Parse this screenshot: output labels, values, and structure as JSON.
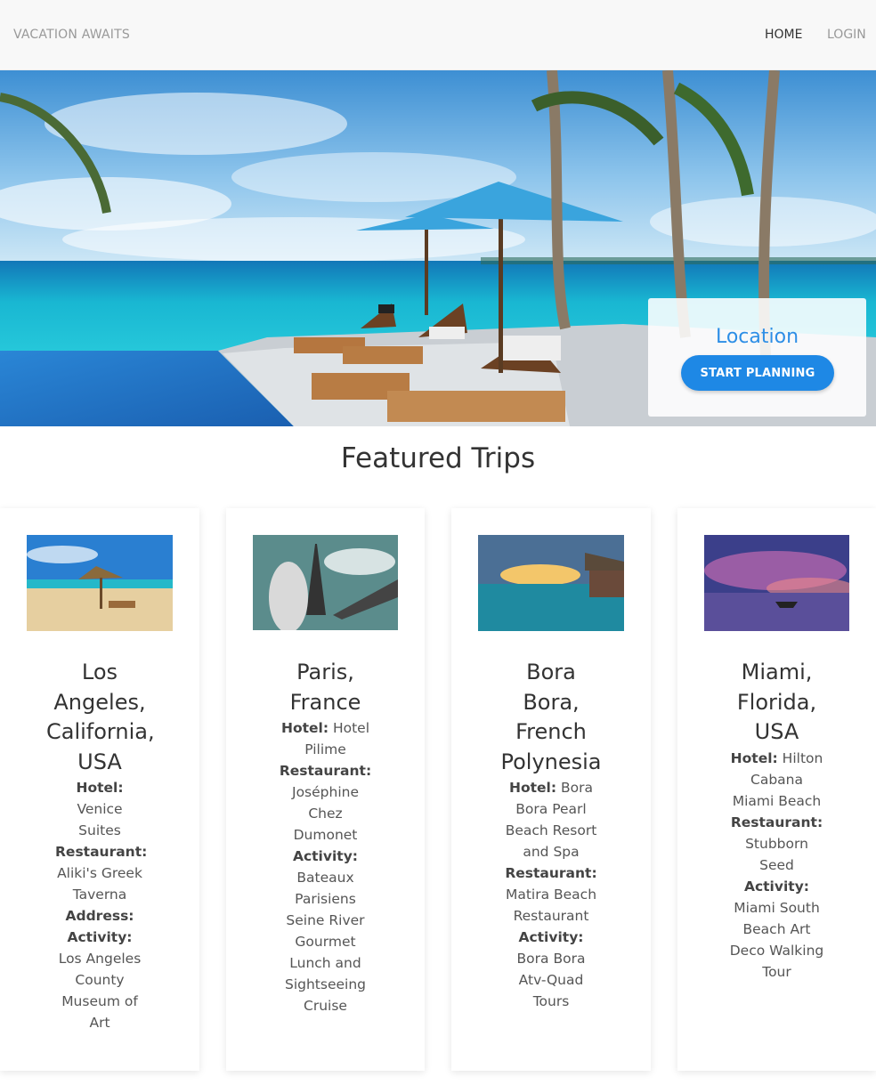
{
  "nav": {
    "brand": "VACATION AWAITS",
    "home": "HOME",
    "login": "LOGIN"
  },
  "hero": {
    "location_label": "Location",
    "cta": "START PLANNING"
  },
  "featured": {
    "title": "Featured Trips",
    "trips": [
      {
        "title_lines": [
          "Los",
          "Angeles,",
          "California,",
          "USA"
        ],
        "hotel_label": "Hotel:",
        "hotel": "Venice Suites",
        "restaurant_label": "Restaurant:",
        "restaurant": "Aliki's Greek Taverna",
        "address_label": "Address:",
        "activity_label": "Activity:",
        "activity": "Los Angeles County Museum of Art"
      },
      {
        "title_lines": [
          "Paris,",
          "France"
        ],
        "hotel_label": "Hotel:",
        "hotel": "Hotel Pilime",
        "restaurant_label": "Restaurant:",
        "restaurant": "Joséphine Chez Dumonet",
        "activity_label": "Activity:",
        "activity": "Bateaux Parisiens Seine River Gourmet Lunch and Sightseeing Cruise"
      },
      {
        "title_lines": [
          "Bora",
          "Bora,",
          "French",
          "Polynesia"
        ],
        "hotel_label": "Hotel:",
        "hotel": "Bora Bora Pearl Beach Resort and Spa",
        "restaurant_label": "Restaurant:",
        "restaurant": "Matira Beach Restaurant",
        "activity_label": "Activity:",
        "activity": "Bora Bora Atv-Quad Tours"
      },
      {
        "title_lines": [
          "Miami,",
          "Florida,",
          "USA"
        ],
        "hotel_label": "Hotel:",
        "hotel": "Hilton Cabana Miami Beach",
        "restaurant_label": "Restaurant:",
        "restaurant": "Stubborn Seed",
        "activity_label": "Activity:",
        "activity": "Miami South Beach Art Deco Walking Tour"
      }
    ]
  },
  "colors": {
    "accent": "#1e88e5",
    "location_text": "#2d8ee6",
    "navbar_bg": "#f8f8f8"
  }
}
